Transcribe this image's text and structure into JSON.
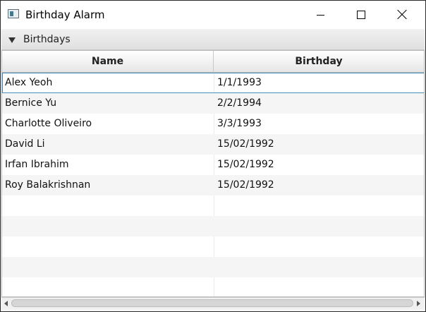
{
  "window": {
    "title": "Birthday Alarm",
    "icon": "app-window-icon"
  },
  "pane": {
    "title": "Birthdays",
    "expanded": true
  },
  "table": {
    "columns": [
      "Name",
      "Birthday"
    ],
    "rows": [
      {
        "name": "Alex Yeoh",
        "birthday": "1/1/1993"
      },
      {
        "name": "Bernice Yu",
        "birthday": "2/2/1994"
      },
      {
        "name": "Charlotte Oliveiro",
        "birthday": "3/3/1993"
      },
      {
        "name": "David Li",
        "birthday": "15/02/1992"
      },
      {
        "name": "Irfan Ibrahim",
        "birthday": "15/02/1992"
      },
      {
        "name": "Roy Balakrishnan",
        "birthday": "15/02/1992"
      }
    ],
    "selected_row": 0
  },
  "colors": {
    "selection_outline": "#4b8fbf",
    "alt_row": "#f5f5f5"
  }
}
